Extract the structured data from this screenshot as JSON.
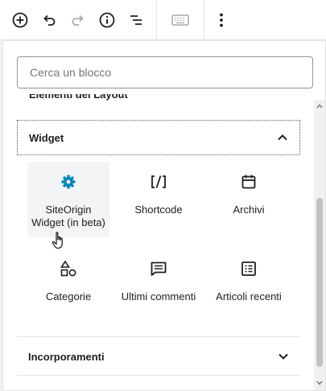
{
  "toolbar": {
    "buttons": [
      {
        "name": "add-block",
        "icon": "plus-circle-icon"
      },
      {
        "name": "undo",
        "icon": "undo-icon"
      },
      {
        "name": "redo",
        "icon": "redo-icon"
      },
      {
        "name": "info",
        "icon": "info-icon"
      },
      {
        "name": "outline",
        "icon": "list-icon"
      },
      {
        "name": "keyboard",
        "icon": "keyboard-icon"
      },
      {
        "name": "more",
        "icon": "more-vertical-icon"
      }
    ]
  },
  "inserter": {
    "search": {
      "placeholder": "Cerca un blocco",
      "value": ""
    },
    "partial_heading": "Elementi del Layout",
    "widget_section": {
      "title": "Widget",
      "expanded": true,
      "blocks": [
        {
          "label": "SiteOrigin Widget (in beta)",
          "icon": "gear-icon",
          "icon_color": "#0085ba"
        },
        {
          "label": "Shortcode",
          "icon": "shortcode-icon"
        },
        {
          "label": "Archivi",
          "icon": "calendar-icon"
        },
        {
          "label": "Categorie",
          "icon": "shapes-icon"
        },
        {
          "label": "Ultimi commenti",
          "icon": "comment-icon"
        },
        {
          "label": "Articoli recenti",
          "icon": "list-view-icon"
        }
      ]
    },
    "embed_section": {
      "title": "Incorporamenti",
      "expanded": false
    }
  },
  "colors": {
    "accent": "#0085ba",
    "text": "#1e1e1e",
    "border": "#e2e4e7",
    "disabled_icon": "#a2aab2"
  }
}
